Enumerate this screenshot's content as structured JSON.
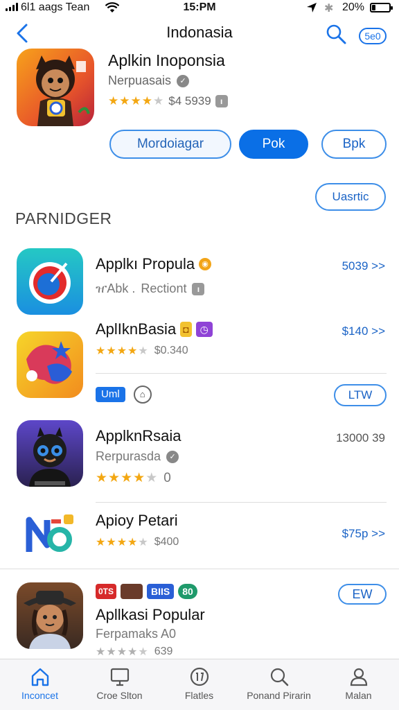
{
  "status_bar": {
    "carrier": "6l1 aags Tean",
    "time": "15:PM",
    "battery_pct": "20%",
    "battery_level": 0.2
  },
  "nav": {
    "title": "Indonasia",
    "badge": "5e0"
  },
  "featured": {
    "title": "Aplkin Inoponsia",
    "subtitle": "Nerpuasais",
    "rating": 4,
    "meta": "$4 5939",
    "buttons": {
      "primary_outline": "Mordoiagar",
      "solid": "Pok",
      "secondary": "Bpk"
    },
    "lists_button": "Uasrtic"
  },
  "section": {
    "title": "PARNIDGER"
  },
  "apps": [
    {
      "title": "Applkı Propula",
      "subtitle": "Rectiont",
      "sub_prefix": "ዠAbk .",
      "price": "5039 >>"
    },
    {
      "title": "AplIknBasia",
      "rating": 4,
      "meta": "$0.340",
      "price": "$140 >>",
      "chip": "Uml",
      "action": "LTW"
    },
    {
      "title": "ApplknRsaia",
      "subtitle": "Rerpurasda",
      "rating": 4,
      "meta": "0",
      "price": "13000 39"
    },
    {
      "title": "Apioy Petari",
      "rating": 4,
      "meta": "$400",
      "price": "$75p >>"
    },
    {
      "title": "Apllkasi Popular",
      "subtitle": "Ferpamaks A0",
      "rating": 4,
      "meta": "639",
      "chips": [
        "0TS",
        "BIIS",
        "80"
      ],
      "action": "EW"
    }
  ],
  "tabs": [
    {
      "label": "Inconcet",
      "icon": "home-icon"
    },
    {
      "label": "Croe Slton",
      "icon": "monitor-icon"
    },
    {
      "label": "Flatles",
      "icon": "compass-icon"
    },
    {
      "label": "Ponand Pirarin",
      "icon": "search-icon"
    },
    {
      "label": "Malan",
      "icon": "person-icon"
    }
  ],
  "colors": {
    "accent": "#0a6fe6",
    "star": "#f3a712",
    "tab_bar": "#f6f6f8"
  }
}
